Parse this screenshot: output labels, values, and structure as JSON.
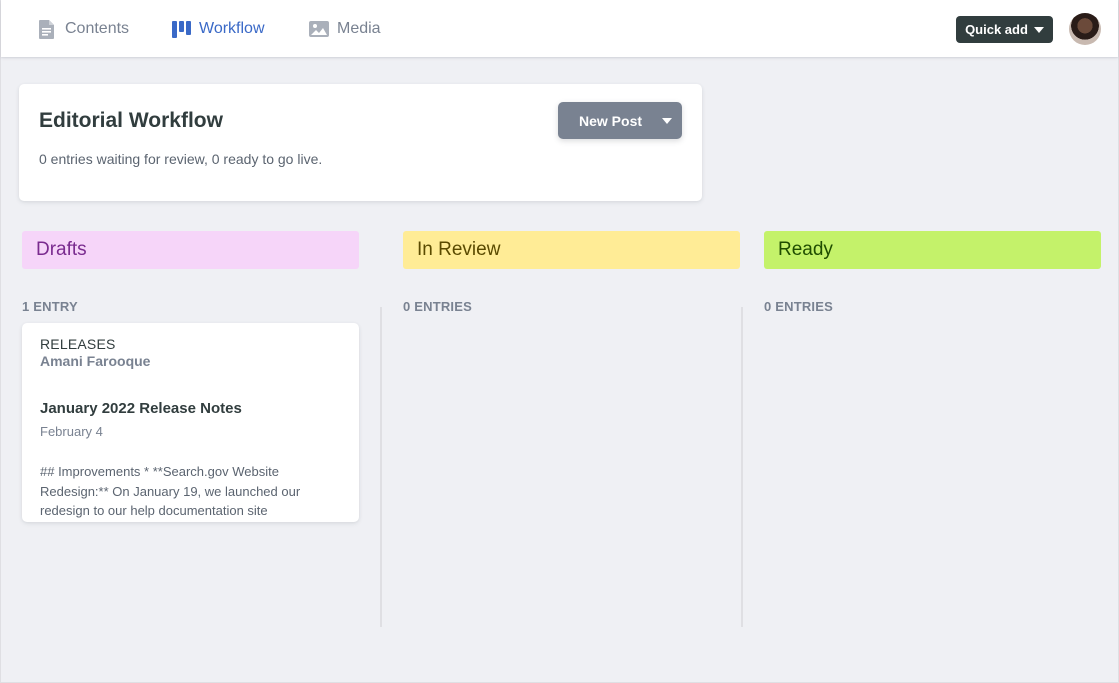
{
  "nav": {
    "items": [
      {
        "label": "Contents",
        "icon": "document-icon",
        "active": false
      },
      {
        "label": "Workflow",
        "icon": "kanban-icon",
        "active": true
      },
      {
        "label": "Media",
        "icon": "image-icon",
        "active": false
      }
    ],
    "quick_add_label": "Quick add"
  },
  "header": {
    "title": "Editorial Workflow",
    "subtitle": "0 entries waiting for review, 0 ready to go live.",
    "new_post_label": "New Post"
  },
  "columns": [
    {
      "name": "Drafts",
      "count_label": "1 ENTRY",
      "bg": "#f6d5f9",
      "fg": "#7a2b8f"
    },
    {
      "name": "In Review",
      "count_label": "0 ENTRIES",
      "bg": "#ffec96",
      "fg": "#5a4a00"
    },
    {
      "name": "Ready",
      "count_label": "0 ENTRIES",
      "bg": "#c4f26a",
      "fg": "#1f4d00"
    }
  ],
  "entry": {
    "collection": "RELEASES",
    "author": "Amani Farooque",
    "title": "January 2022 Release Notes",
    "date": "February 4",
    "excerpt": "## Improvements * **Search.gov Website Redesign:** On January 19, we launched our redesign to our help documentation site"
  },
  "colors": {
    "accent": "#3a69c7",
    "page_bg": "#eff0f4",
    "dark": "#313d3e",
    "muted": "#798291"
  }
}
